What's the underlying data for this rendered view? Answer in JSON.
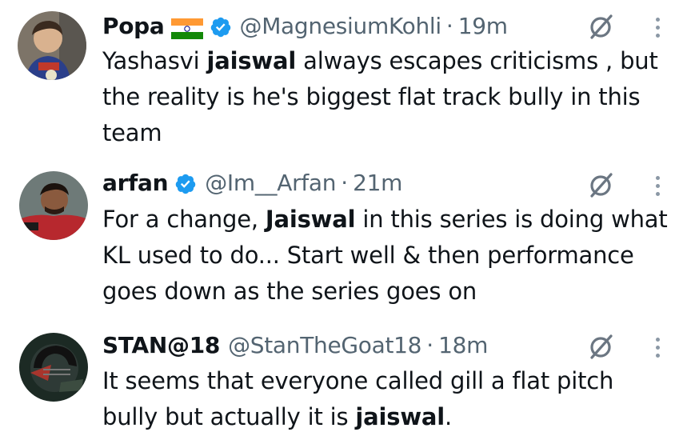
{
  "tweets": [
    {
      "name": "Popa",
      "flag": "india-flag-icon",
      "verified": true,
      "handle": "@MagnesiumKohli",
      "separator": "·",
      "time": "19m",
      "text_parts": [
        {
          "t": "Yashasvi ",
          "bold": false
        },
        {
          "t": "jaiswal",
          "bold": true
        },
        {
          "t": " always escapes criticisms , but the reality is he's biggest flat track bully in this team",
          "bold": false
        }
      ]
    },
    {
      "name": "arfan",
      "verified": true,
      "handle": "@Im__Arfan",
      "separator": "·",
      "time": "21m",
      "text_parts": [
        {
          "t": "For a change, ",
          "bold": false
        },
        {
          "t": "Jaiswal",
          "bold": true
        },
        {
          "t": " in this series is doing what KL used to do... Start well & then performance goes down as the series goes on",
          "bold": false
        }
      ]
    },
    {
      "name": "STAN@18",
      "verified": false,
      "handle": "@StanTheGoat18",
      "separator": "·",
      "time": "18m",
      "text_parts": [
        {
          "t": "It seems that everyone called gill a flat pitch bully but actually it is ",
          "bold": false
        },
        {
          "t": "jaiswal",
          "bold": true
        },
        {
          "t": ".",
          "bold": false
        }
      ]
    }
  ],
  "colors": {
    "text": "#0f1419",
    "secondary": "#536471",
    "verified": "#1d9bf0"
  }
}
